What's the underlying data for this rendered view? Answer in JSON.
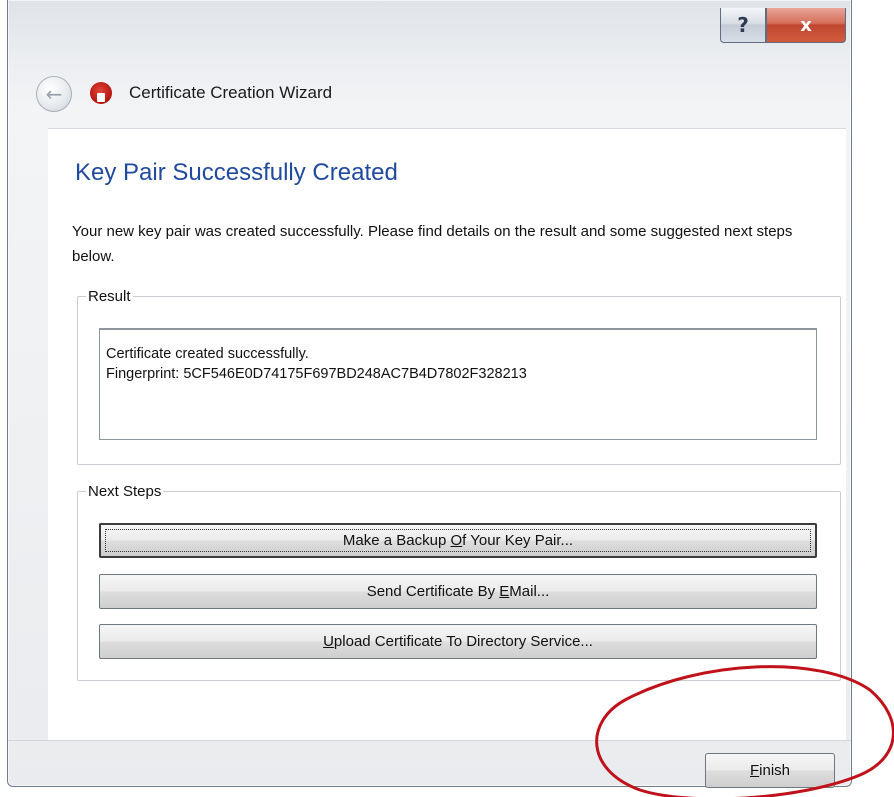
{
  "window": {
    "title": "Certificate Creation Wizard",
    "help_glyph": "?",
    "close_glyph": "x",
    "back_glyph": "←"
  },
  "page": {
    "heading": "Key Pair Successfully Created",
    "description": "Your new key pair was created successfully. Please find details on the result and some suggested next steps below."
  },
  "result": {
    "legend": "Result",
    "line1": "Certificate created successfully.",
    "line2": "Fingerprint: 5CF546E0D74175F697BD248AC7B4D7802F328213"
  },
  "next_steps": {
    "legend": "Next Steps",
    "backup": {
      "prefix": "Make a Backup ",
      "underlined": "O",
      "suffix": "f Your Key Pair..."
    },
    "email": {
      "prefix": "Send Certificate By ",
      "underlined": "E",
      "suffix": "Mail..."
    },
    "upload": {
      "prefix": "",
      "underlined": "U",
      "suffix": "pload Certificate To Directory Service..."
    }
  },
  "footer": {
    "finish": {
      "underlined": "F",
      "suffix": "inish"
    }
  },
  "colors": {
    "heading": "#1f4aa0",
    "close_button": "#c14630",
    "annotation": "#c0121a"
  }
}
